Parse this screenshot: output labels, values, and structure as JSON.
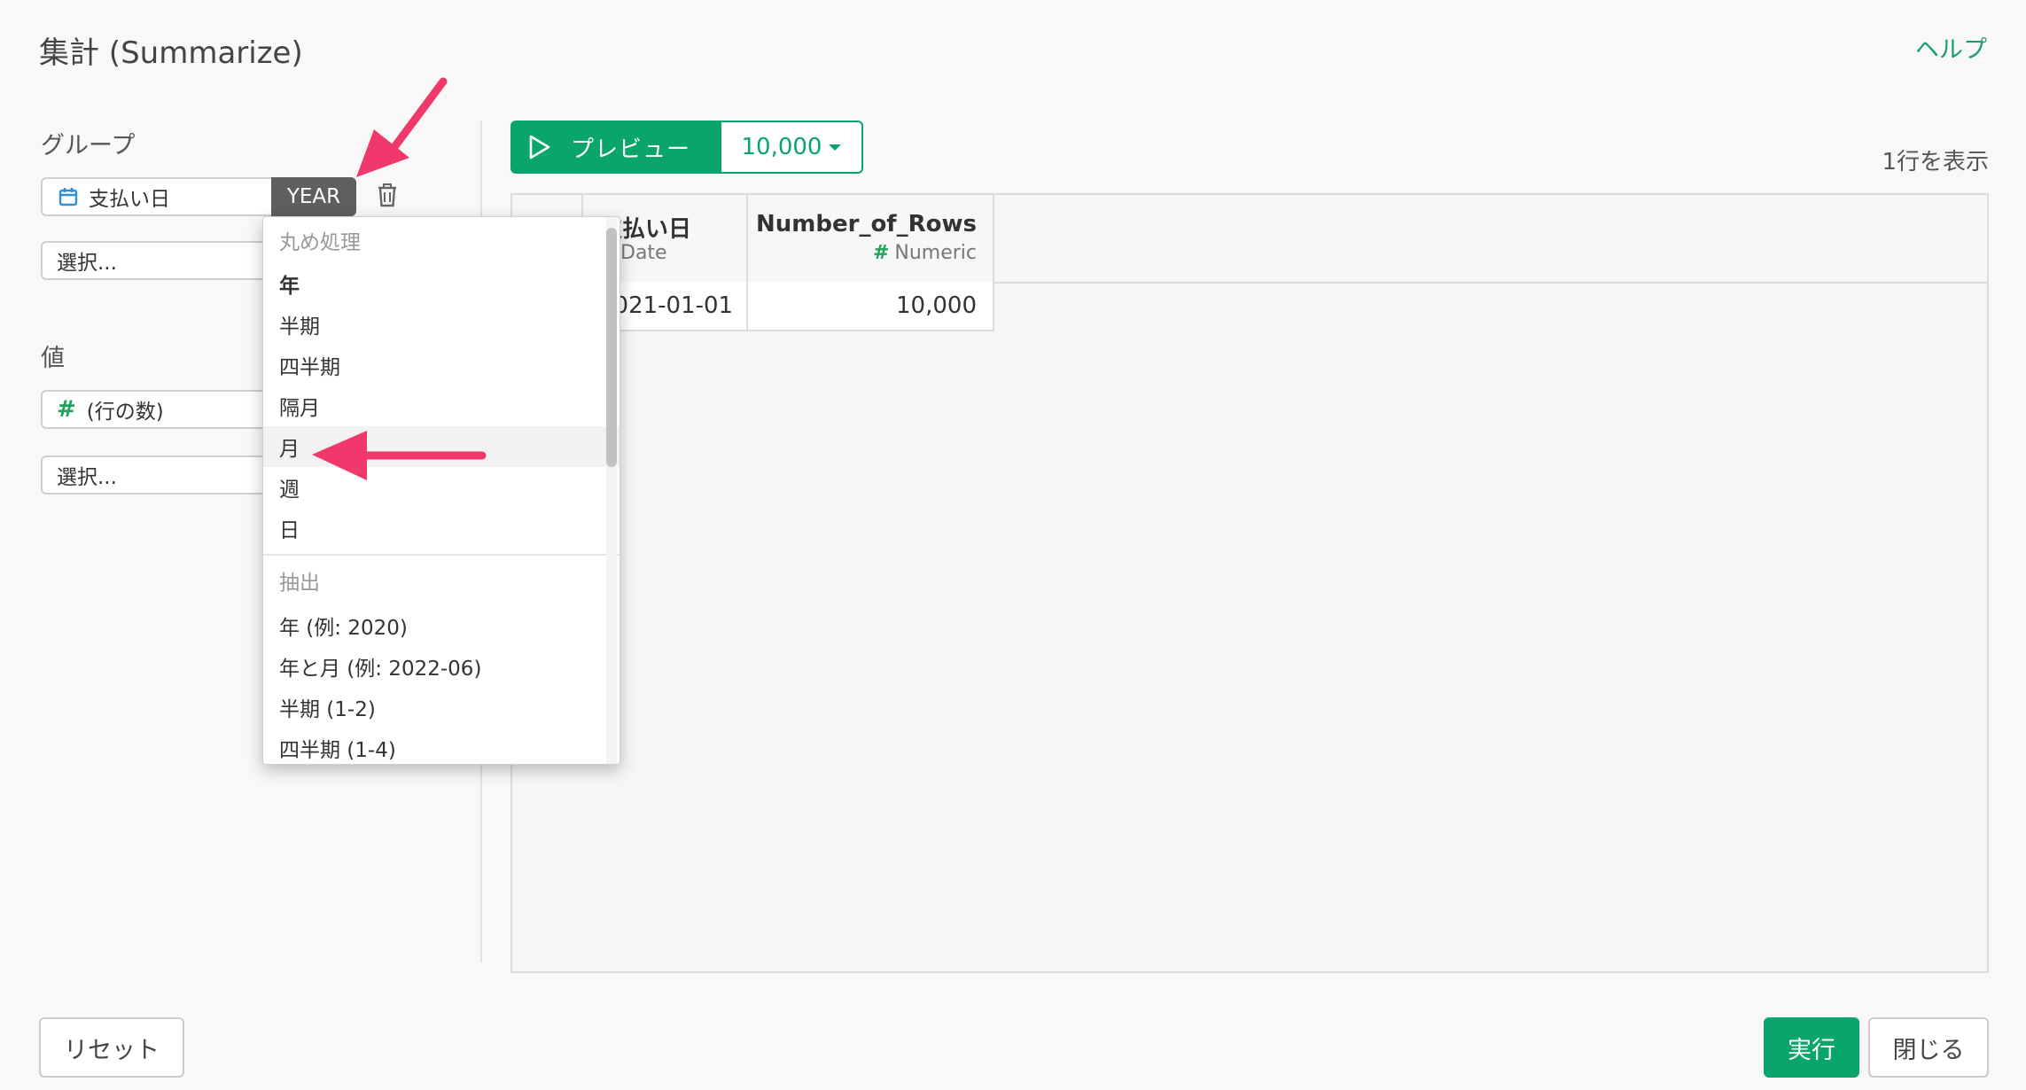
{
  "dialog": {
    "title": "集計 (Summarize)",
    "help_label": "ヘルプ"
  },
  "left": {
    "group_label": "グループ",
    "group_column": "支払い日",
    "group_rounding": "YEAR",
    "select_placeholder_1": "選択...",
    "value_label": "値",
    "value_column": "(行の数)",
    "select_placeholder_2": "選択..."
  },
  "preview": {
    "button_label": "プレビュー",
    "row_limit": "10,000",
    "rows_info": "1行を表示"
  },
  "table": {
    "columns": [
      {
        "name": "支払い日",
        "type": "Date"
      },
      {
        "name": "Number_of_Rows",
        "type": "Numeric"
      }
    ],
    "rows": [
      [
        "2021-01-01",
        "10,000"
      ]
    ]
  },
  "dropdown": {
    "round_header": "丸め処理",
    "round_items": [
      "年",
      "半期",
      "四半期",
      "隔月",
      "月",
      "週",
      "日"
    ],
    "extract_header": "抽出",
    "extract_items": [
      "年 (例: 2020)",
      "年と月 (例: 2022-06)",
      "半期 (1-2)",
      "四半期 (1-4)"
    ]
  },
  "footer": {
    "reset_label": "リセット",
    "run_label": "実行",
    "close_label": "閉じる"
  },
  "colors": {
    "accent": "#0aa56c",
    "annotation_arrow": "#f0386b",
    "year_badge": "#5f5f5f"
  }
}
